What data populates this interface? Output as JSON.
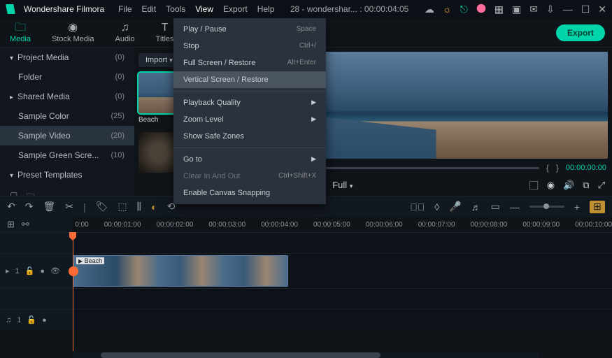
{
  "app": {
    "name": "Wondershare Filmora"
  },
  "menubar": [
    "File",
    "Edit",
    "Tools",
    "View",
    "Export",
    "Help"
  ],
  "menubar_open_index": 3,
  "title_center": "28  -  wondershar... : 00:00:04:05",
  "tabs": [
    {
      "label": "Media",
      "icon": "folder"
    },
    {
      "label": "Stock Media",
      "icon": "camera"
    },
    {
      "label": "Audio",
      "icon": "music"
    },
    {
      "label": "Titles",
      "icon": "text"
    }
  ],
  "export_btn": "Export",
  "sidebar": {
    "items": [
      {
        "label": "Project Media",
        "count": "(0)",
        "caret": true
      },
      {
        "label": "Folder",
        "count": "(0)",
        "caret": false,
        "sub": true
      },
      {
        "label": "Shared Media",
        "count": "(0)",
        "caret": true
      },
      {
        "label": "Sample Color",
        "count": "(25)",
        "caret": false
      },
      {
        "label": "Sample Video",
        "count": "(20)",
        "caret": false,
        "sel": true
      },
      {
        "label": "Sample Green Scre...",
        "count": "(10)",
        "caret": false
      },
      {
        "label": "Preset Templates",
        "count": "",
        "caret": true
      }
    ]
  },
  "import_label": "Import",
  "media_thumbs": [
    {
      "label": "Beach",
      "sel": true
    },
    {
      "label": "",
      "sel": false
    }
  ],
  "dropdown": {
    "items": [
      {
        "label": "Play / Pause",
        "shortcut": "Space"
      },
      {
        "label": "Stop",
        "shortcut": "Ctrl+/"
      },
      {
        "label": "Full Screen / Restore",
        "shortcut": "Alt+Enter"
      },
      {
        "label": "Vertical Screen / Restore",
        "shortcut": "",
        "hov": true
      },
      {
        "sep": true
      },
      {
        "label": "Playback Quality",
        "shortcut": "",
        "sub": true
      },
      {
        "label": "Zoom Level",
        "shortcut": "",
        "sub": true
      },
      {
        "label": "Show Safe Zones",
        "shortcut": ""
      },
      {
        "sep": true
      },
      {
        "label": "Go to",
        "shortcut": "",
        "sub": true
      },
      {
        "label": "Clear In And Out",
        "shortcut": "Ctrl+Shift+X",
        "dis": true
      },
      {
        "label": "Enable Canvas Snapping",
        "shortcut": ""
      }
    ]
  },
  "preview": {
    "full_label": "Full",
    "time": "00:00:00:00"
  },
  "ruler": [
    "0:00",
    "00:00:01:00",
    "00:00:02:00",
    "00:00:03:00",
    "00:00:04:00",
    "00:00:05:00",
    "00:00:06:00",
    "00:00:07:00",
    "00:00:08:00",
    "00:00:09:00",
    "00:00:10:00"
  ],
  "tracks": {
    "video_label": "1",
    "audio_label": "1",
    "clip_label": "Beach"
  }
}
